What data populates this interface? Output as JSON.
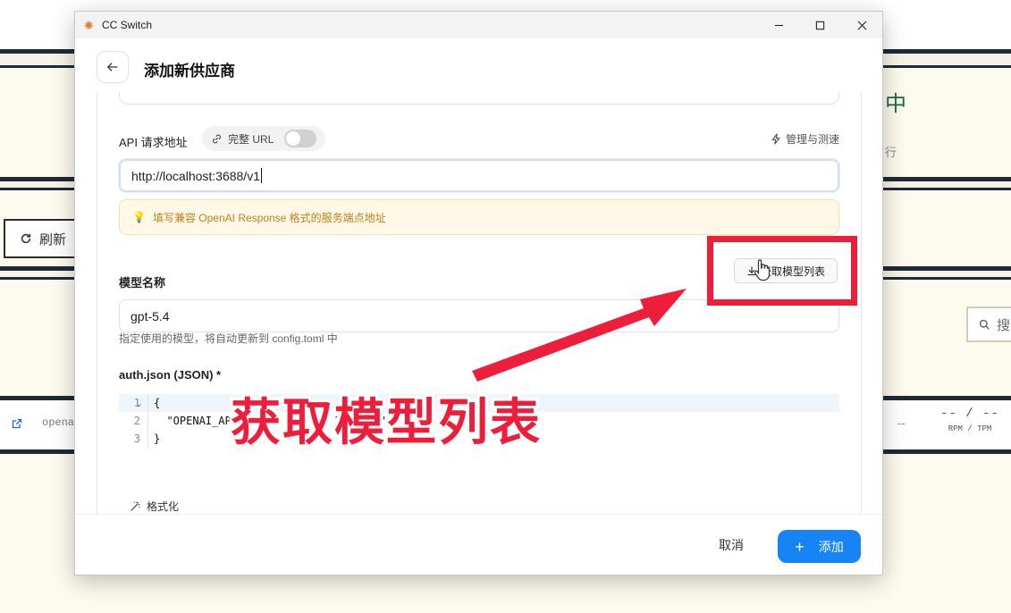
{
  "window": {
    "title": "CC Switch",
    "app_icon": "sun-icon"
  },
  "header": {
    "title": "添加新供应商",
    "back_icon": "arrow-left-icon"
  },
  "api_url": {
    "label": "API 请求地址",
    "full_url_label": "完整 URL",
    "full_url_enabled": false,
    "manage_label": "管理与测速",
    "value": "http://localhost:3688/v1",
    "hint": "填写兼容 OpenAI Response 格式的服务端点地址"
  },
  "model": {
    "label": "模型名称",
    "fetch_button": "获取模型列表",
    "value": "gpt-5.4",
    "helper": "指定使用的模型，将自动更新到 config.toml 中"
  },
  "auth": {
    "label": "auth.json (JSON) *",
    "lines": [
      {
        "num": "1",
        "text": "{"
      },
      {
        "num": "2",
        "text": "  \"OPENAI_AP      K    :    3     6\""
      },
      {
        "num": "3",
        "text": "}"
      }
    ],
    "format_label": "格式化"
  },
  "footer": {
    "cancel": "取消",
    "add": "添加"
  },
  "annotation": {
    "text": "获取模型列表",
    "color": "#ee1d3a"
  },
  "background": {
    "refresh": "刷新",
    "zh_char": "中",
    "xing_char": "行",
    "search_char": "搜",
    "row_name": "opena",
    "dash": "--",
    "rpm_value": "-- / --",
    "rpm_label": "RPM / TPM"
  },
  "colors": {
    "accent": "#1684f5",
    "hint_text": "#c2801b",
    "annotation": "#ee1d3a"
  }
}
